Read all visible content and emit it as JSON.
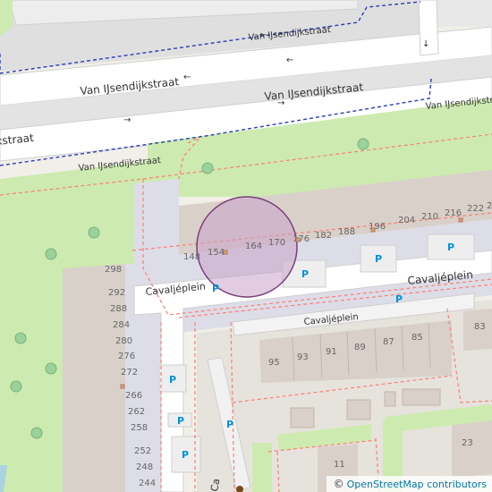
{
  "map": {
    "streets": {
      "van_ijsendijkstraat": "Van IJsendijkstraat",
      "cavaljeplein": "Cavaljéplein"
    },
    "street_truncated": {
      "left_edge": "kstraat",
      "bottom_edge": "Ca"
    },
    "house_numbers": {
      "row_top": [
        "148",
        "154",
        "164",
        "170",
        "176",
        "182",
        "188",
        "196",
        "204",
        "210",
        "216",
        "222",
        "2"
      ],
      "column_left": [
        "298",
        "292",
        "288",
        "284",
        "280",
        "276",
        "272",
        "266",
        "262",
        "258",
        "252",
        "248",
        "244"
      ],
      "row_block": [
        "95",
        "93",
        "91",
        "89",
        "87",
        "85"
      ],
      "other": [
        "83",
        "23",
        "11"
      ]
    },
    "parking_symbol": "P",
    "highlight": {
      "fill": "#c8a2c8",
      "stroke": "#7a3f7a",
      "opacity": 0.55
    }
  },
  "attribution": {
    "prefix": "©",
    "link_text": "OpenStreetMap contributors"
  }
}
